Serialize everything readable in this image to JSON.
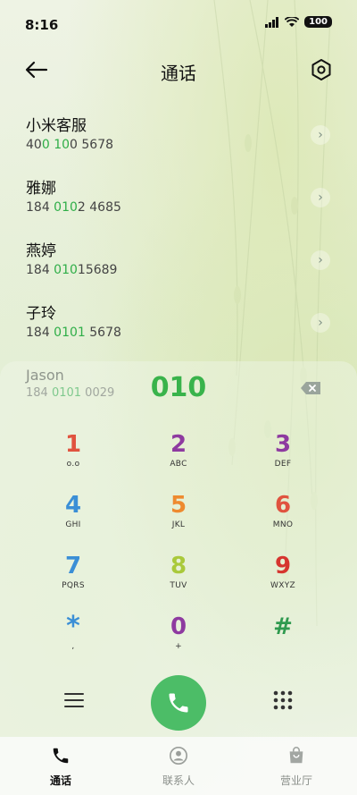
{
  "status_bar": {
    "time": "8:16",
    "battery": "100"
  },
  "header": {
    "title": "通话"
  },
  "results": [
    {
      "name": "小米客服",
      "num_a": "40",
      "num_b": "0",
      "num_c": " ",
      "num_d": "10",
      "num_e": "0 5678"
    },
    {
      "name": "雅娜",
      "num_a": "184 ",
      "num_b": "010",
      "num_c": "2 4685",
      "num_d": "",
      "num_e": ""
    },
    {
      "name": "燕婷",
      "num_a": "184 ",
      "num_b": "010",
      "num_c": "15689",
      "num_d": "",
      "num_e": ""
    },
    {
      "name": "子玲",
      "num_a": "184 ",
      "num_b": "0101",
      "num_c": " 5678",
      "num_d": "",
      "num_e": ""
    }
  ],
  "suggestion": {
    "name": "Jason",
    "num_a": "184 ",
    "num_b": "0101",
    "num_c": " 0029"
  },
  "typed_number": "010",
  "keypad": [
    {
      "digit": "1",
      "letters": "ᴏ.ᴏ",
      "color": "#e0533f"
    },
    {
      "digit": "2",
      "letters": "ABC",
      "color": "#8e3aa0"
    },
    {
      "digit": "3",
      "letters": "DEF",
      "color": "#8e3aa0"
    },
    {
      "digit": "4",
      "letters": "GHI",
      "color": "#3b8fd6"
    },
    {
      "digit": "5",
      "letters": "JKL",
      "color": "#ee8a2f"
    },
    {
      "digit": "6",
      "letters": "MNO",
      "color": "#e0533f"
    },
    {
      "digit": "7",
      "letters": "PQRS",
      "color": "#3b8fd6"
    },
    {
      "digit": "8",
      "letters": "TUV",
      "color": "#a9c93a"
    },
    {
      "digit": "9",
      "letters": "WXYZ",
      "color": "#d6352f"
    },
    {
      "digit": "*",
      "letters": ",",
      "color": "#3b8fd6"
    },
    {
      "digit": "0",
      "letters": "+",
      "color": "#8e3aa0"
    },
    {
      "digit": "#",
      "letters": "",
      "color": "#2f9a4f"
    }
  ],
  "tabs": [
    {
      "label": "通话",
      "active": true
    },
    {
      "label": "联系人",
      "active": false
    },
    {
      "label": "营业厅",
      "active": false
    }
  ],
  "icons": {
    "back": "back-arrow-icon",
    "settings": "settings-hexagon-icon",
    "chevron": "chevron-right-icon",
    "backspace": "backspace-icon",
    "menu": "menu-icon",
    "call": "phone-icon",
    "dialpad": "dialpad-icon"
  },
  "colors": {
    "accent": "#39b34b",
    "call_button": "#4cbd67"
  }
}
